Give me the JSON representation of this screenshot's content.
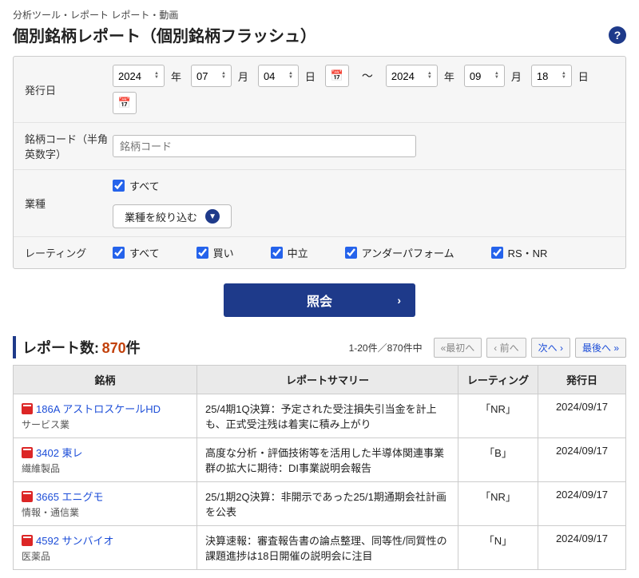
{
  "breadcrumb": "分析ツール・レポート レポート・動画",
  "page_title": "個別銘柄レポート（個別銘柄フラッシュ）",
  "filter": {
    "date_label": "発行日",
    "year_unit": "年",
    "month_unit": "月",
    "day_unit": "日",
    "from": {
      "year": "2024",
      "month": "07",
      "day": "04"
    },
    "to": {
      "year": "2024",
      "month": "09",
      "day": "18"
    },
    "code_label": "銘柄コード（半角英数字）",
    "code_placeholder": "銘柄コード",
    "sector_label": "業種",
    "all_label": "すべて",
    "narrow_btn": "業種を絞り込む",
    "rating_label": "レーティング",
    "ratings": [
      "すべて",
      "買い",
      "中立",
      "アンダーパフォーム",
      "RS・NR"
    ]
  },
  "submit_label": "照会",
  "results": {
    "count_label": "レポート数:",
    "count": "870",
    "count_suffix": "件",
    "range": "1-20件／870件中",
    "pager": {
      "first": "«最初へ",
      "prev": "‹ 前へ",
      "next": "次へ ›",
      "last": "最後へ »"
    }
  },
  "table": {
    "headers": {
      "stock": "銘柄",
      "summary": "レポートサマリー",
      "rating": "レーティング",
      "date": "発行日"
    },
    "rows": [
      {
        "code": "186A",
        "name": "アストロスケールHD",
        "sector": "サービス業",
        "summary": "25/4期1Q決算：予定された受注損失引当金を計上も、正式受注残は着実に積み上がり",
        "rating": "「NR」",
        "date": "2024/09/17"
      },
      {
        "code": "3402",
        "name": "東レ",
        "sector": "繊維製品",
        "summary": "高度な分析・評価技術等を活用した半導体関連事業群の拡大に期待：DI事業説明会報告",
        "rating": "「B」",
        "date": "2024/09/17"
      },
      {
        "code": "3665",
        "name": "エニグモ",
        "sector": "情報・通信業",
        "summary": "25/1期2Q決算：非開示であった25/1期通期会社計画を公表",
        "rating": "「NR」",
        "date": "2024/09/17"
      },
      {
        "code": "4592",
        "name": "サンバイオ",
        "sector": "医薬品",
        "summary": "決算速報：審査報告書の論点整理、同等性/同質性の課題進捗は18日開催の説明会に注目",
        "rating": "「N」",
        "date": "2024/09/17"
      }
    ]
  }
}
